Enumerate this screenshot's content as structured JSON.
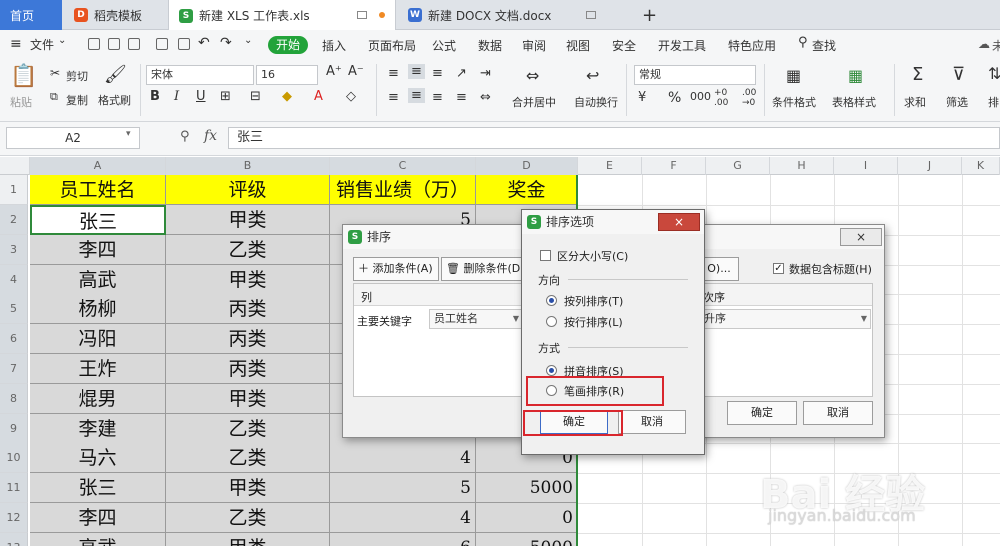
{
  "tabs": [
    {
      "label": "首页"
    },
    {
      "label": "稻壳模板",
      "icon": "docer-icon"
    },
    {
      "label": "新建 XLS 工作表.xls",
      "icon": "spreadsheet-icon"
    },
    {
      "label": "新建 DOCX 文档.docx",
      "icon": "writer-icon"
    },
    {
      "label": "+"
    }
  ],
  "menu": {
    "file": "文件",
    "start": "开始",
    "items": [
      "插入",
      "页面布局",
      "公式",
      "数据",
      "审阅",
      "视图",
      "安全",
      "开发工具",
      "特色应用"
    ],
    "search": "查找",
    "right_cut": "未"
  },
  "ribbon": {
    "paste": "粘贴",
    "cut": "剪切",
    "copy": "复制",
    "format_painter": "格式刷",
    "font_name": "宋体",
    "font_size": "16",
    "merge_center": "合并居中",
    "wrap": "自动换行",
    "number_format": "常规",
    "percent": "%",
    "cond_format": "条件格式",
    "table_style": "表格样式",
    "sum": "求和",
    "filter": "筛选",
    "sort_cut": "排"
  },
  "formula_bar": {
    "name_box": "A2",
    "fx": "fx",
    "value": "张三"
  },
  "columns": [
    "A",
    "B",
    "C",
    "D",
    "E",
    "F",
    "G",
    "H",
    "I",
    "J",
    "K"
  ],
  "rows": [
    "1",
    "2",
    "3",
    "4",
    "5",
    "6",
    "7",
    "8",
    "9",
    "10",
    "11",
    "12",
    "13"
  ],
  "table": {
    "headers": [
      "员工姓名",
      "评级",
      "销售业绩（万）",
      "奖金"
    ],
    "rows": [
      [
        "张三",
        "甲类",
        "5",
        ""
      ],
      [
        "李四",
        "乙类",
        "",
        ""
      ],
      [
        "高武",
        "甲类",
        "",
        ""
      ],
      [
        "杨柳",
        "丙类",
        "",
        ""
      ],
      [
        "冯阳",
        "丙类",
        "",
        ""
      ],
      [
        "王炸",
        "丙类",
        "",
        ""
      ],
      [
        "焜男",
        "甲类",
        "",
        ""
      ],
      [
        "李建",
        "乙类",
        "",
        ""
      ],
      [
        "马六",
        "乙类",
        "4",
        "0"
      ],
      [
        "张三",
        "甲类",
        "5",
        "5000"
      ],
      [
        "李四",
        "乙类",
        "4",
        "0"
      ],
      [
        "高武",
        "甲类",
        "6",
        "5000"
      ]
    ]
  },
  "sort_dialog": {
    "title": "排序",
    "add_condition": "添加条件(A)",
    "delete_condition": "删除条件(D)",
    "options_cut": "O)...",
    "has_header": "数据包含标题(H)",
    "col_header": "列",
    "order_header": "次序",
    "primary_key_label": "主要关键字",
    "primary_key_value": "员工姓名",
    "order_value": "升序",
    "ok": "确定",
    "cancel": "取消",
    "close": "×"
  },
  "sort_options": {
    "title": "排序选项",
    "case_sensitive": "区分大小写(C)",
    "direction": "方向",
    "by_column": "按列排序(T)",
    "by_row": "按行排序(L)",
    "method": "方式",
    "pinyin": "拼音排序(S)",
    "stroke": "笔画排序(R)",
    "ok": "确定",
    "cancel": "取消",
    "close": "×"
  },
  "watermark": {
    "brand": "Bai 经验",
    "url": "jingyan.baidu.com"
  }
}
